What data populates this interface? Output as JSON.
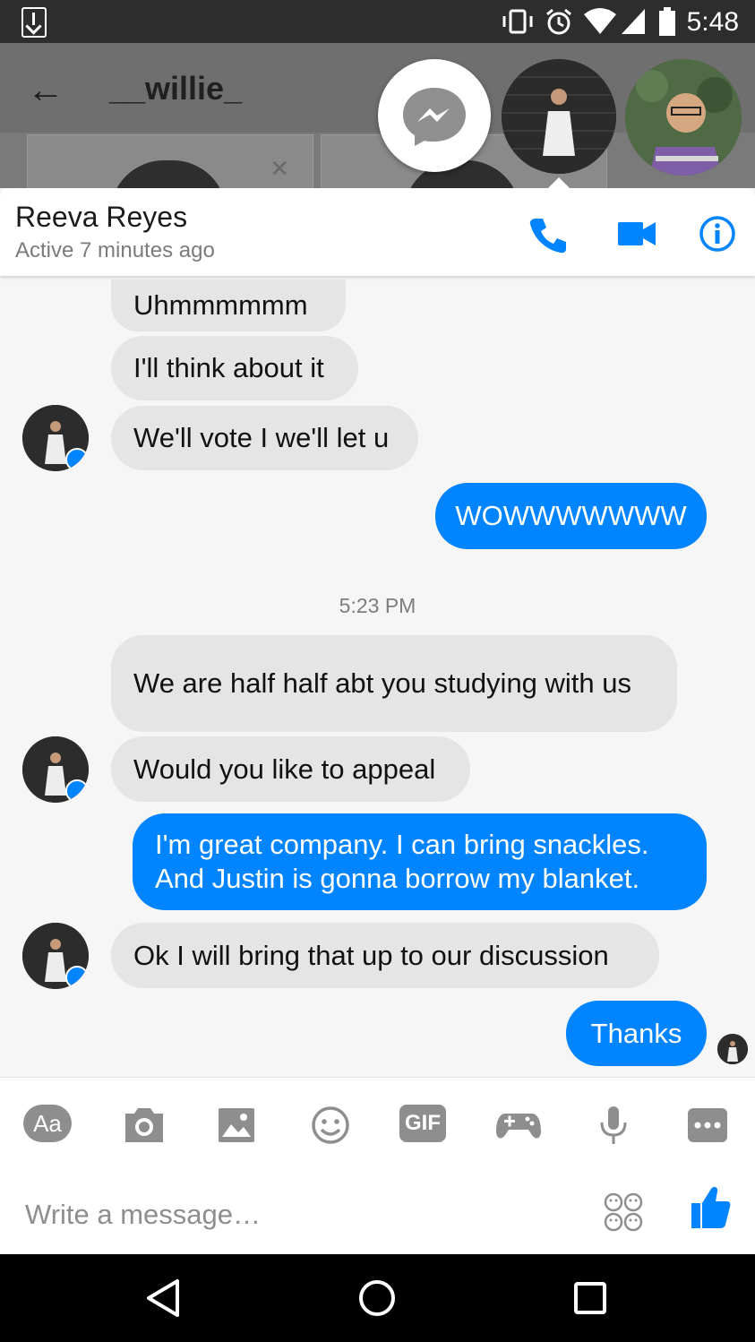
{
  "status_bar": {
    "time": "5:48"
  },
  "underlying_header": {
    "title": "__willie_"
  },
  "conversation": {
    "contact_name": "Reeva Reyes",
    "contact_status": "Active 7 minutes ago"
  },
  "messages": [
    {
      "side": "in",
      "text": "Uhmmmmmm"
    },
    {
      "side": "in",
      "text": "I'll think about it"
    },
    {
      "side": "in",
      "text": "We'll vote I we'll let u"
    },
    {
      "side": "out",
      "text": "WOWWWWWWW"
    },
    {
      "side": "in",
      "text": "We are half half abt you studying with us"
    },
    {
      "side": "in",
      "text": "Would you like to appeal"
    },
    {
      "side": "out",
      "text": "I'm great company. I can bring snackles. And Justin is gonna borrow my blanket."
    },
    {
      "side": "in",
      "text": "Ok I will bring that up to our discussion"
    },
    {
      "side": "out",
      "text": "Thanks"
    }
  ],
  "timestamp": "5:23 PM",
  "composer": {
    "placeholder": "Write a message…",
    "aa_label": "Aa",
    "gif_label": "GIF"
  },
  "colors": {
    "accent": "#0084ff",
    "incoming_bubble": "#e5e5e5",
    "background": "#f6f6f6"
  },
  "icons": [
    "back-arrow-icon",
    "messenger-icon",
    "phone-icon",
    "video-camera-icon",
    "info-icon",
    "camera-icon",
    "image-icon",
    "emoji-icon",
    "gif-icon",
    "game-controller-icon",
    "microphone-icon",
    "more-icon",
    "stickers-icon",
    "thumbs-up-icon"
  ]
}
